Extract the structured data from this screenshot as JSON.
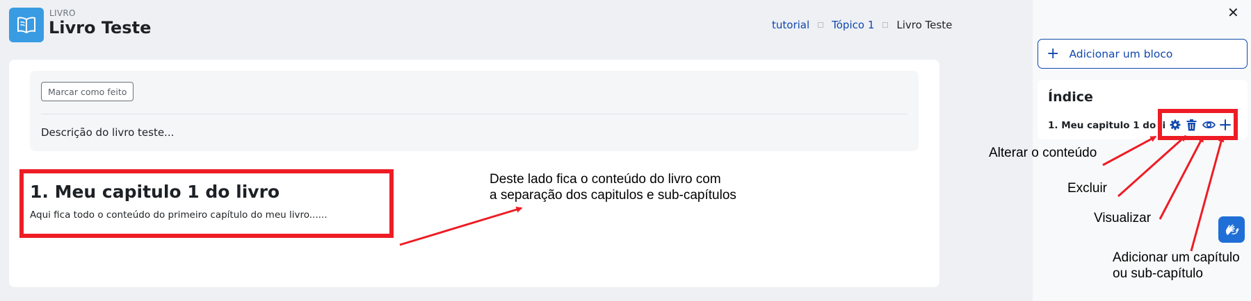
{
  "header": {
    "eyebrow": "LIVRO",
    "title": "Livro Teste",
    "icon": "book-open-icon"
  },
  "breadcrumb": {
    "items": [
      "tutorial",
      "Tópico 1"
    ],
    "current": "Livro Teste"
  },
  "activity": {
    "mark_done_label": "Marcar como feito",
    "description": "Descrição do livro teste..."
  },
  "chapter": {
    "title": "1. Meu capitulo 1 do livro",
    "text": "Aqui fica todo o conteúdo do primeiro capítulo do meu livro......"
  },
  "drawer": {
    "close_label": "✕",
    "add_block_label": "Adicionar um bloco",
    "index_title": "Índice",
    "index_item": "1. Meu capitulo 1 do livro",
    "item_actions": [
      "gear-icon",
      "trash-icon",
      "eye-icon",
      "plus-icon"
    ]
  },
  "annotations": {
    "content_note_line1": "Deste lado fica o conteúdo do livro com",
    "content_note_line2": "a separação dos capitulos e sub-capítulos",
    "edit_note": "Alterar o conteúdo",
    "delete_note": "Excluir",
    "view_note": "Visualizar",
    "add_note_line1": "Adicionar um capítulo",
    "add_note_line2": "ou sub-capítulo"
  },
  "colors": {
    "accent": "#0f47ad",
    "annotation_red": "#ee1c25",
    "icon_blue": "#399be2"
  }
}
